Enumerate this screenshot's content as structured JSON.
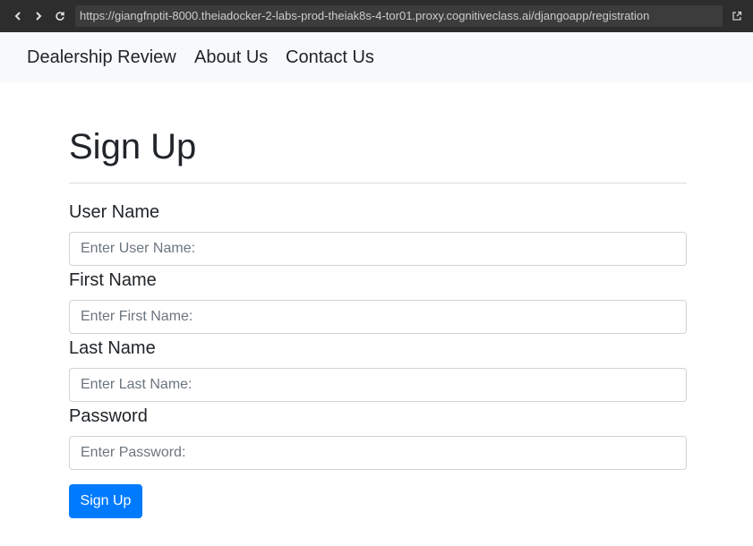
{
  "browser": {
    "url": "https://giangfnptit-8000.theiadocker-2-labs-prod-theiak8s-4-tor01.proxy.cognitiveclass.ai/djangoapp/registration",
    "icons": [
      "back-icon",
      "forward-icon",
      "reload-icon",
      "open-external-icon"
    ]
  },
  "navbar": {
    "links": [
      {
        "label": "Dealership Review"
      },
      {
        "label": "About Us"
      },
      {
        "label": "Contact Us"
      }
    ]
  },
  "form": {
    "title": "Sign Up",
    "fields": [
      {
        "label": "User Name",
        "placeholder": "Enter User Name:",
        "value": ""
      },
      {
        "label": "First Name",
        "placeholder": "Enter First Name:",
        "value": ""
      },
      {
        "label": "Last Name",
        "placeholder": "Enter Last Name:",
        "value": ""
      },
      {
        "label": "Password",
        "placeholder": "Enter Password:",
        "value": ""
      }
    ],
    "submit_label": "Sign Up"
  },
  "colors": {
    "browser_bar": "#2d2d2d",
    "navbar_bg": "#f8f9fa",
    "primary": "#007bff",
    "text": "#212529"
  }
}
